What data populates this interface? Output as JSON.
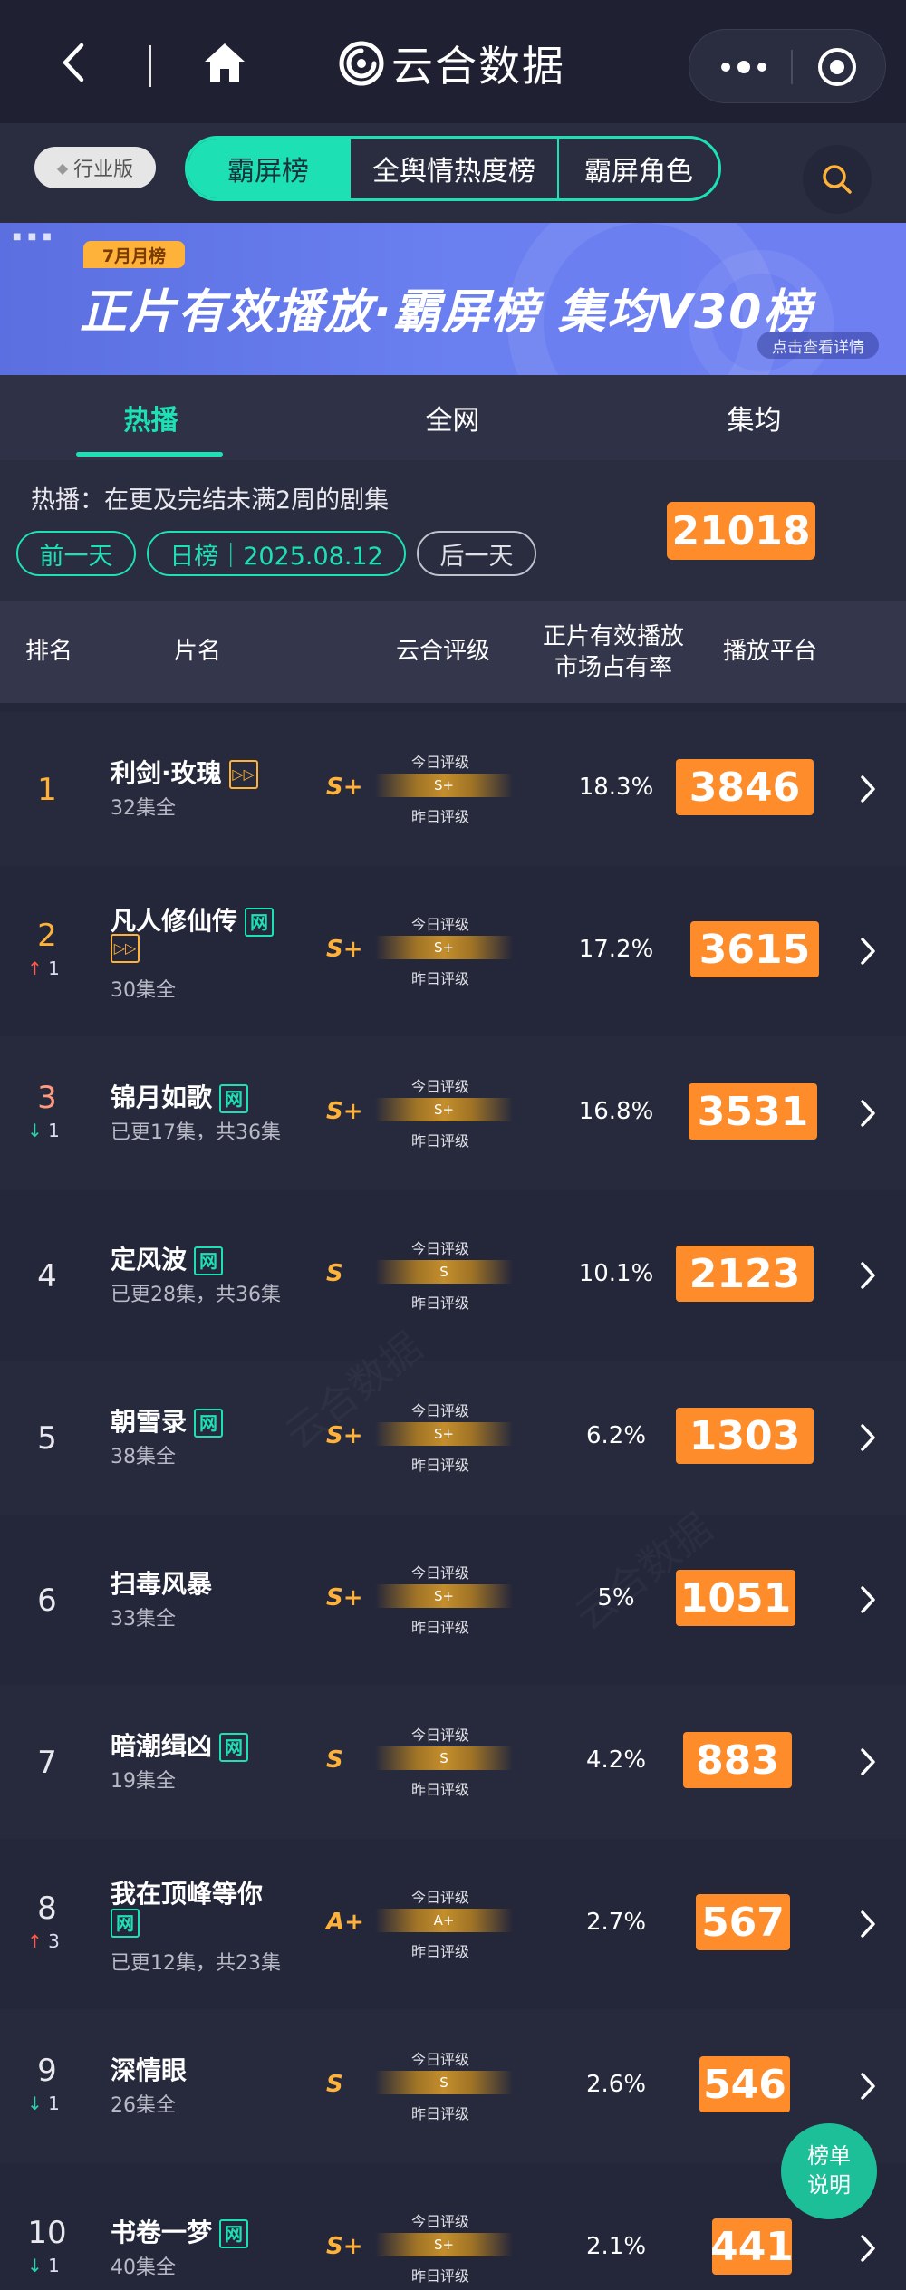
{
  "app": {
    "brand": "云合数据"
  },
  "nav": {
    "industry_label": "行业版",
    "segments": [
      "霸屏榜",
      "全舆情热度榜",
      "霸屏角色"
    ]
  },
  "banner": {
    "month_tag": "7月月榜",
    "title": "正片有效播放·霸屏榜 集均V30榜",
    "detail": "点击查看详情"
  },
  "tabs": [
    "热播",
    "全网",
    "集均"
  ],
  "filter": {
    "description": "热播：在更及完结未满2周的剧集",
    "prev": "前一天",
    "date": "日榜｜2025.08.12",
    "next": "后一天",
    "total": "21018"
  },
  "table_header": {
    "rank": "排名",
    "title": "片名",
    "rating": "云合评级",
    "share": "正片有效播放\n市场占有率",
    "platform": "播放平台"
  },
  "grade_labels": {
    "today": "今日评级",
    "yesterday": "昨日评级"
  },
  "rows": [
    {
      "rank": "1",
      "change": "",
      "dir": "",
      "name": "利剑·玫瑰",
      "sub": "32集全",
      "badge": "",
      "badge2": "",
      "grade": "S+",
      "bar": "S+",
      "share": "18.3%",
      "score": "3846"
    },
    {
      "rank": "2",
      "change": "1",
      "dir": "up",
      "name": "凡人修仙传",
      "sub": "30集全",
      "badge": "网",
      "badge2": "",
      "grade": "S+",
      "bar": "S+",
      "share": "17.2%",
      "score": "3615"
    },
    {
      "rank": "3",
      "change": "1",
      "dir": "down",
      "name": "锦月如歌",
      "sub": "已更17集，共36集",
      "badge": "网",
      "badge2": "",
      "grade": "S+",
      "bar": "S+",
      "share": "16.8%",
      "score": "3531"
    },
    {
      "rank": "4",
      "change": "",
      "dir": "",
      "name": "定风波",
      "sub": "已更28集，共36集",
      "badge": "网",
      "badge2": "",
      "grade": "S",
      "bar": "S",
      "share": "10.1%",
      "score": "2123"
    },
    {
      "rank": "5",
      "change": "",
      "dir": "",
      "name": "朝雪录",
      "sub": "38集全",
      "badge": "网",
      "badge2": "",
      "grade": "S+",
      "bar": "S+",
      "share": "6.2%",
      "score": "1303"
    },
    {
      "rank": "6",
      "change": "",
      "dir": "",
      "name": "扫毒风暴",
      "sub": "33集全",
      "badge": "",
      "badge2": "",
      "grade": "S+",
      "bar": "S+",
      "share": "5%",
      "score": "1051"
    },
    {
      "rank": "7",
      "change": "",
      "dir": "",
      "name": "暗潮缉凶",
      "sub": "19集全",
      "badge": "网",
      "badge2": "",
      "grade": "S",
      "bar": "S",
      "share": "4.2%",
      "score": "883"
    },
    {
      "rank": "8",
      "change": "3",
      "dir": "up",
      "name": "我在顶峰等你",
      "sub": "已更12集，共23集",
      "badge": "网",
      "badge2": "",
      "grade": "A+",
      "bar": "A+",
      "share": "2.7%",
      "score": "567"
    },
    {
      "rank": "9",
      "change": "1",
      "dir": "down",
      "name": "深情眼",
      "sub": "26集全",
      "badge": "",
      "badge2": "",
      "grade": "S",
      "bar": "S",
      "share": "2.6%",
      "score": "546"
    },
    {
      "rank": "10",
      "change": "1",
      "dir": "down",
      "name": "书卷一梦",
      "sub": "40集全",
      "badge": "网",
      "badge2": "",
      "grade": "S+",
      "bar": "S+",
      "share": "2.1%",
      "score": "441"
    }
  ],
  "help": {
    "line1": "榜单",
    "line2": "说明"
  },
  "colors": {
    "accent": "#1de0b5",
    "score_bg": "#ff8c2b",
    "grade": "#ffb23a",
    "background": "#24263a"
  }
}
